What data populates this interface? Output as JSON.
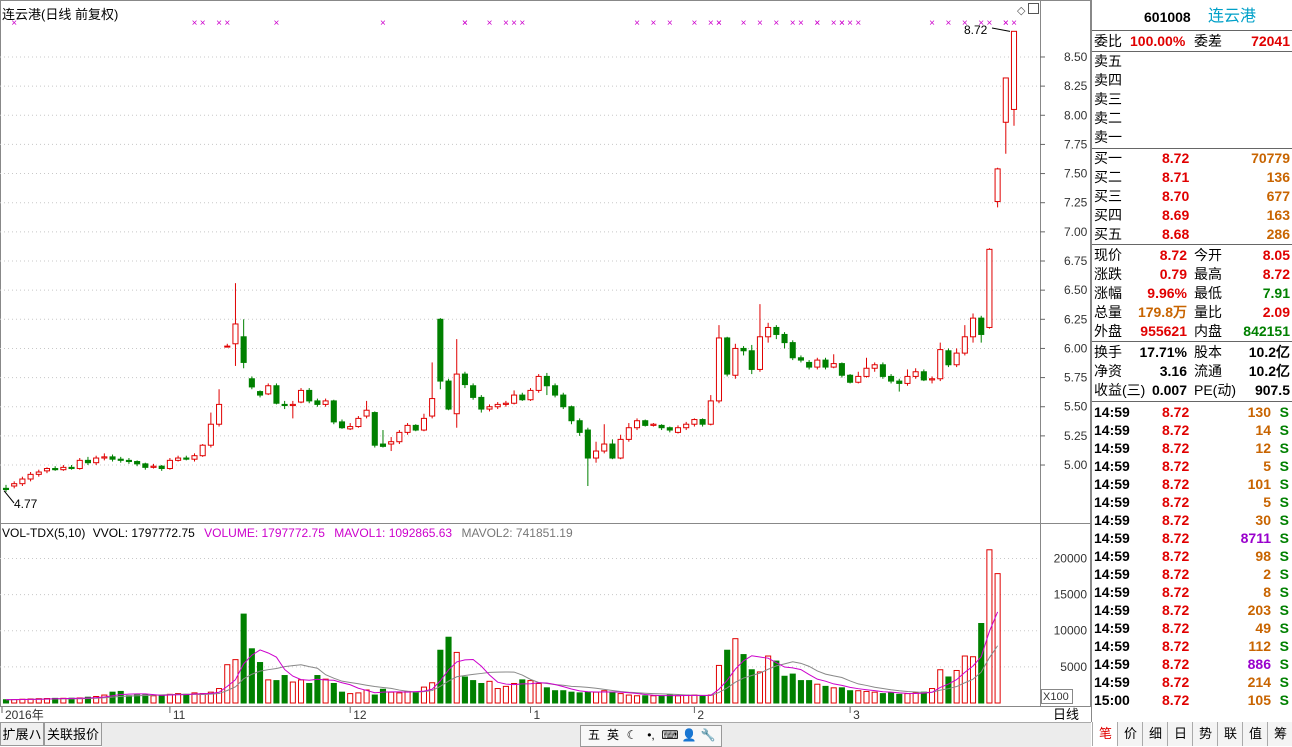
{
  "chart_title": "连云港(日线 前复权)",
  "price_axis": {
    "ticks": [
      "8.50",
      "8.25",
      "8.00",
      "7.75",
      "7.50",
      "7.25",
      "7.00",
      "6.75",
      "6.50",
      "6.25",
      "6.00",
      "5.75",
      "5.50",
      "5.25",
      "5.00"
    ],
    "high_label": "8.72",
    "low_label": "4.77"
  },
  "volume_header": {
    "name": "VOL-TDX(5,10)",
    "vvol": "VVOL: 1797772.75",
    "volume": "VOLUME: 1797772.75",
    "mavol1": "MAVOL1: 1092865.63",
    "mavol2": "MAVOL2: 741851.19",
    "ticks": [
      "20000",
      "15000",
      "10000",
      "5000"
    ],
    "unit": "X100"
  },
  "date_axis": [
    "2016年",
    "11",
    "12",
    "1",
    "2",
    "3"
  ],
  "period_label": "日线",
  "bottom_tabs": [
    "扩展ハ",
    "关联报价"
  ],
  "colors": {
    "up": "#e00000",
    "down": "#008000",
    "ma1": "#cc00cc",
    "ma2": "#888888",
    "grid": "#cccccc"
  },
  "chart_data": {
    "type": "candlestick",
    "ylim": [
      4.7,
      8.8
    ],
    "candles": [
      [
        4.8,
        4.79,
        4.83,
        4.77
      ],
      [
        4.82,
        4.84,
        4.86,
        4.8
      ],
      [
        4.84,
        4.88,
        4.9,
        4.82
      ],
      [
        4.88,
        4.92,
        4.94,
        4.86
      ],
      [
        4.92,
        4.94,
        4.96,
        4.9
      ],
      [
        4.95,
        4.97,
        4.98,
        4.93
      ],
      [
        4.97,
        4.96,
        4.99,
        4.95
      ],
      [
        4.96,
        4.98,
        5.0,
        4.95
      ],
      [
        4.98,
        4.97,
        5.0,
        4.96
      ],
      [
        4.97,
        5.04,
        5.06,
        4.96
      ],
      [
        5.04,
        5.02,
        5.07,
        5.0
      ],
      [
        5.02,
        5.06,
        5.08,
        5.0
      ],
      [
        5.06,
        5.07,
        5.1,
        5.04
      ],
      [
        5.07,
        5.05,
        5.09,
        5.03
      ],
      [
        5.05,
        5.04,
        5.07,
        5.02
      ],
      [
        5.04,
        5.03,
        5.06,
        5.01
      ],
      [
        5.03,
        5.01,
        5.04,
        4.99
      ],
      [
        5.01,
        4.98,
        5.02,
        4.96
      ],
      [
        4.98,
        4.99,
        5.01,
        4.97
      ],
      [
        4.99,
        4.97,
        5.0,
        4.95
      ],
      [
        4.97,
        5.04,
        5.06,
        4.96
      ],
      [
        5.04,
        5.06,
        5.08,
        5.03
      ],
      [
        5.06,
        5.05,
        5.08,
        5.04
      ],
      [
        5.05,
        5.08,
        5.1,
        5.03
      ],
      [
        5.08,
        5.17,
        5.18,
        5.07
      ],
      [
        5.17,
        5.35,
        5.45,
        5.15
      ],
      [
        5.35,
        5.52,
        5.65,
        5.33
      ],
      [
        6.02,
        6.02,
        6.04,
        6.02
      ],
      [
        6.04,
        6.21,
        6.56,
        5.85
      ],
      [
        6.1,
        5.88,
        6.25,
        5.83
      ],
      [
        5.74,
        5.67,
        5.76,
        5.65
      ],
      [
        5.63,
        5.6,
        5.64,
        5.58
      ],
      [
        5.61,
        5.68,
        5.7,
        5.6
      ],
      [
        5.68,
        5.53,
        5.7,
        5.52
      ],
      [
        5.52,
        5.51,
        5.55,
        5.48
      ],
      [
        5.51,
        5.52,
        5.55,
        5.4
      ],
      [
        5.54,
        5.64,
        5.66,
        5.53
      ],
      [
        5.64,
        5.55,
        5.66,
        5.53
      ],
      [
        5.55,
        5.52,
        5.57,
        5.5
      ],
      [
        5.52,
        5.55,
        5.57,
        5.5
      ],
      [
        5.55,
        5.37,
        5.56,
        5.35
      ],
      [
        5.37,
        5.32,
        5.39,
        5.31
      ],
      [
        5.31,
        5.33,
        5.36,
        5.3
      ],
      [
        5.33,
        5.4,
        5.42,
        5.32
      ],
      [
        5.42,
        5.47,
        5.55,
        5.4
      ],
      [
        5.45,
        5.17,
        5.46,
        5.15
      ],
      [
        5.18,
        5.16,
        5.3,
        5.15
      ],
      [
        5.18,
        5.2,
        5.24,
        5.12
      ],
      [
        5.2,
        5.28,
        5.3,
        5.18
      ],
      [
        5.28,
        5.34,
        5.36,
        5.26
      ],
      [
        5.34,
        5.3,
        5.35,
        5.29
      ],
      [
        5.3,
        5.4,
        5.44,
        5.29
      ],
      [
        5.42,
        5.57,
        5.88,
        5.4
      ],
      [
        6.25,
        5.72,
        6.26,
        5.65
      ],
      [
        5.72,
        5.48,
        5.74,
        5.47
      ],
      [
        5.44,
        5.78,
        6.08,
        5.32
      ],
      [
        5.78,
        5.69,
        5.8,
        5.66
      ],
      [
        5.68,
        5.58,
        5.7,
        5.56
      ],
      [
        5.58,
        5.48,
        5.6,
        5.45
      ],
      [
        5.48,
        5.5,
        5.52,
        5.46
      ],
      [
        5.5,
        5.52,
        5.54,
        5.48
      ],
      [
        5.52,
        5.53,
        5.55,
        5.5
      ],
      [
        5.53,
        5.6,
        5.64,
        5.52
      ],
      [
        5.6,
        5.56,
        5.62,
        5.55
      ],
      [
        5.56,
        5.64,
        5.66,
        5.55
      ],
      [
        5.64,
        5.76,
        5.78,
        5.62
      ],
      [
        5.76,
        5.68,
        5.79,
        5.6
      ],
      [
        5.68,
        5.6,
        5.7,
        5.58
      ],
      [
        5.6,
        5.5,
        5.62,
        5.48
      ],
      [
        5.5,
        5.38,
        5.51,
        5.35
      ],
      [
        5.38,
        5.28,
        5.4,
        5.25
      ],
      [
        5.3,
        5.06,
        5.32,
        4.82
      ],
      [
        5.06,
        5.12,
        5.2,
        5.02
      ],
      [
        5.12,
        5.18,
        5.35,
        5.1
      ],
      [
        5.18,
        5.06,
        5.22,
        5.05
      ],
      [
        5.06,
        5.22,
        5.26,
        5.05
      ],
      [
        5.22,
        5.32,
        5.36,
        5.2
      ],
      [
        5.32,
        5.38,
        5.4,
        5.3
      ],
      [
        5.38,
        5.34,
        5.39,
        5.33
      ],
      [
        5.34,
        5.35,
        5.36,
        5.33
      ],
      [
        5.34,
        5.32,
        5.35,
        5.3
      ],
      [
        5.32,
        5.3,
        5.33,
        5.28
      ],
      [
        5.28,
        5.32,
        5.34,
        5.27
      ],
      [
        5.32,
        5.35,
        5.37,
        5.3
      ],
      [
        5.35,
        5.39,
        5.4,
        5.33
      ],
      [
        5.39,
        5.35,
        5.4,
        5.33
      ],
      [
        5.35,
        5.55,
        5.6,
        5.34
      ],
      [
        5.55,
        6.09,
        6.2,
        5.53
      ],
      [
        6.09,
        5.78,
        6.1,
        5.76
      ],
      [
        5.77,
        6.0,
        6.04,
        5.74
      ],
      [
        6.0,
        5.98,
        6.02,
        5.94
      ],
      [
        5.98,
        5.82,
        6.03,
        5.78
      ],
      [
        5.82,
        6.1,
        6.38,
        5.8
      ],
      [
        6.1,
        6.18,
        6.22,
        6.05
      ],
      [
        6.18,
        6.12,
        6.2,
        6.08
      ],
      [
        6.12,
        6.05,
        6.14,
        6.0
      ],
      [
        6.05,
        5.92,
        6.07,
        5.9
      ],
      [
        5.92,
        5.9,
        5.94,
        5.88
      ],
      [
        5.88,
        5.84,
        5.9,
        5.82
      ],
      [
        5.84,
        5.9,
        5.92,
        5.82
      ],
      [
        5.9,
        5.84,
        5.92,
        5.82
      ],
      [
        5.84,
        5.87,
        5.95,
        5.83
      ],
      [
        5.87,
        5.77,
        5.88,
        5.75
      ],
      [
        5.77,
        5.71,
        5.78,
        5.7
      ],
      [
        5.71,
        5.76,
        5.8,
        5.7
      ],
      [
        5.76,
        5.83,
        5.92,
        5.75
      ],
      [
        5.83,
        5.86,
        5.88,
        5.8
      ],
      [
        5.86,
        5.76,
        5.88,
        5.74
      ],
      [
        5.76,
        5.72,
        5.78,
        5.7
      ],
      [
        5.72,
        5.7,
        5.74,
        5.63
      ],
      [
        5.7,
        5.76,
        5.82,
        5.68
      ],
      [
        5.76,
        5.8,
        5.83,
        5.74
      ],
      [
        5.8,
        5.73,
        5.82,
        5.72
      ],
      [
        5.73,
        5.74,
        5.76,
        5.7
      ],
      [
        5.74,
        5.99,
        6.05,
        5.72
      ],
      [
        5.98,
        5.86,
        6.0,
        5.84
      ],
      [
        5.86,
        5.96,
        6.0,
        5.84
      ],
      [
        5.96,
        6.1,
        6.2,
        5.94
      ],
      [
        6.1,
        6.26,
        6.3,
        6.05
      ],
      [
        6.26,
        6.12,
        6.28,
        6.05
      ],
      [
        6.18,
        6.85,
        6.86,
        6.17
      ],
      [
        7.26,
        7.54,
        7.55,
        7.21
      ],
      [
        7.94,
        8.32,
        8.32,
        7.67
      ],
      [
        8.05,
        8.72,
        8.72,
        7.91
      ]
    ],
    "volumes": [
      450,
      480,
      520,
      560,
      600,
      620,
      640,
      650,
      660,
      700,
      800,
      900,
      1100,
      1500,
      1600,
      1000,
      1100,
      1100,
      1000,
      1100,
      1200,
      1300,
      1200,
      1400,
      1300,
      1500,
      2000,
      5300,
      6000,
      12300,
      7500,
      5600,
      3200,
      3100,
      3800,
      2900,
      3200,
      2700,
      3800,
      3300,
      2700,
      1500,
      1300,
      1400,
      1800,
      1100,
      1900,
      1500,
      1400,
      1600,
      1500,
      2200,
      2800,
      7300,
      9100,
      7000,
      3600,
      3100,
      2700,
      3000,
      2000,
      2300,
      2700,
      3200,
      3100,
      2700,
      2100,
      1700,
      1700,
      1500,
      1400,
      1500,
      1500,
      1700,
      1500,
      1300,
      1100,
      1000,
      1000,
      1000,
      1000,
      1100,
      1000,
      1100,
      1100,
      1000,
      1100,
      5200,
      7300,
      8900,
      6700,
      4600,
      4300,
      6500,
      5800,
      3700,
      4000,
      3100,
      3100,
      2600,
      2300,
      2100,
      2100,
      1700,
      1700,
      1600,
      1500,
      1300,
      1400,
      1200,
      1300,
      1400,
      1500,
      2000,
      4600,
      3600,
      4500,
      6500,
      6400,
      11000,
      21200,
      17900
    ],
    "volume_ylim": [
      0,
      22000
    ]
  },
  "quote": {
    "code": "601008",
    "name": "连云港",
    "weibi_label": "委比",
    "weibi_value": "100.00%",
    "weicha_label": "委差",
    "weicha_value": "72041",
    "sells": [
      {
        "label": "卖五",
        "price": "",
        "vol": ""
      },
      {
        "label": "卖四",
        "price": "",
        "vol": ""
      },
      {
        "label": "卖三",
        "price": "",
        "vol": ""
      },
      {
        "label": "卖二",
        "price": "",
        "vol": ""
      },
      {
        "label": "卖一",
        "price": "",
        "vol": ""
      }
    ],
    "buys": [
      {
        "label": "买一",
        "price": "8.72",
        "vol": "70779"
      },
      {
        "label": "买二",
        "price": "8.71",
        "vol": "136"
      },
      {
        "label": "买三",
        "price": "8.70",
        "vol": "677"
      },
      {
        "label": "买四",
        "price": "8.69",
        "vol": "163"
      },
      {
        "label": "买五",
        "price": "8.68",
        "vol": "286"
      }
    ],
    "stats": [
      {
        "l1": "现价",
        "v1": "8.72",
        "l2": "今开",
        "v2": "8.05"
      },
      {
        "l1": "涨跌",
        "v1": "0.79",
        "l2": "最高",
        "v2": "8.72"
      },
      {
        "l1": "涨幅",
        "v1": "9.96%",
        "l2": "最低",
        "v2": "7.91"
      },
      {
        "l1": "总量",
        "v1": "179.8万",
        "l2": "量比",
        "v2": "2.09"
      },
      {
        "l1": "外盘",
        "v1": "955621",
        "l2": "内盘",
        "v2": "842151"
      }
    ],
    "fundamentals": [
      {
        "l1": "换手",
        "v1": "17.71%",
        "l2": "股本",
        "v2": "10.2亿"
      },
      {
        "l1": "净资",
        "v1": "3.16",
        "l2": "流通",
        "v2": "10.2亿"
      },
      {
        "l1": "收益(三)",
        "v1": "0.007",
        "l2": "PE(动)",
        "v2": "907.5"
      }
    ],
    "ticks": [
      {
        "time": "14:59",
        "price": "8.72",
        "vol": "130",
        "side": "S"
      },
      {
        "time": "14:59",
        "price": "8.72",
        "vol": "14",
        "side": "S"
      },
      {
        "time": "14:59",
        "price": "8.72",
        "vol": "12",
        "side": "S"
      },
      {
        "time": "14:59",
        "price": "8.72",
        "vol": "5",
        "side": "S"
      },
      {
        "time": "14:59",
        "price": "8.72",
        "vol": "101",
        "side": "S"
      },
      {
        "time": "14:59",
        "price": "8.72",
        "vol": "5",
        "side": "S"
      },
      {
        "time": "14:59",
        "price": "8.72",
        "vol": "30",
        "side": "S"
      },
      {
        "time": "14:59",
        "price": "8.72",
        "vol": "8711",
        "side": "S"
      },
      {
        "time": "14:59",
        "price": "8.72",
        "vol": "98",
        "side": "S"
      },
      {
        "time": "14:59",
        "price": "8.72",
        "vol": "2",
        "side": "S"
      },
      {
        "time": "14:59",
        "price": "8.72",
        "vol": "8",
        "side": "S"
      },
      {
        "time": "14:59",
        "price": "8.72",
        "vol": "203",
        "side": "S"
      },
      {
        "time": "14:59",
        "price": "8.72",
        "vol": "49",
        "side": "S"
      },
      {
        "time": "14:59",
        "price": "8.72",
        "vol": "112",
        "side": "S"
      },
      {
        "time": "14:59",
        "price": "8.72",
        "vol": "886",
        "side": "S"
      },
      {
        "time": "14:59",
        "price": "8.72",
        "vol": "214",
        "side": "S"
      },
      {
        "time": "15:00",
        "price": "8.72",
        "vol": "105",
        "side": "S"
      }
    ],
    "tabs": [
      "笔",
      "价",
      "细",
      "日",
      "势",
      "联",
      "值",
      "筹"
    ]
  },
  "toolbar_icons": [
    {
      "name": "five-grid-icon",
      "glyph": "五"
    },
    {
      "name": "english-mode-icon",
      "glyph": "英"
    },
    {
      "name": "moon-icon",
      "glyph": "☾"
    },
    {
      "name": "punctuation-icon",
      "glyph": "•,"
    },
    {
      "name": "keyboard-icon",
      "glyph": "⌨"
    },
    {
      "name": "user-icon",
      "glyph": "👤"
    },
    {
      "name": "settings-icon",
      "glyph": "🔧"
    }
  ]
}
